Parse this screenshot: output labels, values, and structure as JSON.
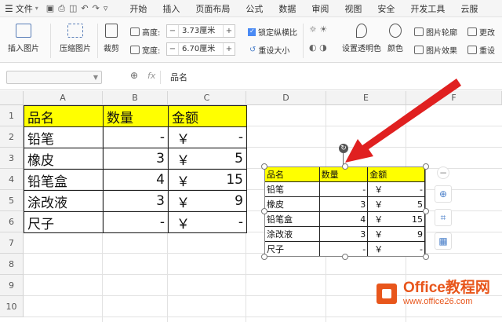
{
  "menu": {
    "file_label": "文件",
    "tabs": [
      "开始",
      "插入",
      "页面布局",
      "公式",
      "数据",
      "审阅",
      "视图",
      "安全",
      "开发工具",
      "云服"
    ]
  },
  "ribbon": {
    "insert_picture": "插入图片",
    "compress_picture": "压缩图片",
    "crop": "裁剪",
    "height_label": "高度:",
    "height_value": "3.73厘米",
    "width_label": "宽度:",
    "width_value": "6.70厘米",
    "lock_ratio": "锁定纵横比",
    "reset_size": "重设大小",
    "set_transparent": "设置透明色",
    "color": "颜色",
    "picture_outline": "图片轮廓",
    "picture_effect": "图片效果",
    "change": "更改",
    "reset": "重设"
  },
  "formula_bar": {
    "fx": "fx",
    "content": "品名"
  },
  "columns": [
    "A",
    "B",
    "C",
    "D",
    "E",
    "F"
  ],
  "rows": [
    "1",
    "2",
    "3",
    "4",
    "5",
    "6",
    "7",
    "8",
    "9",
    "10"
  ],
  "table": {
    "headers": [
      "品名",
      "数量",
      "金额"
    ],
    "currency": "￥",
    "rows": [
      {
        "name": "铅笔",
        "qty": "-",
        "amount": "-"
      },
      {
        "name": "橡皮",
        "qty": "3",
        "amount": "5"
      },
      {
        "name": "铅笔盒",
        "qty": "4",
        "amount": "15"
      },
      {
        "name": "涂改液",
        "qty": "3",
        "amount": "9"
      },
      {
        "name": "尺子",
        "qty": "-",
        "amount": "-"
      }
    ]
  },
  "logo": {
    "title": "Office教程网",
    "url": "www.office26.com"
  }
}
